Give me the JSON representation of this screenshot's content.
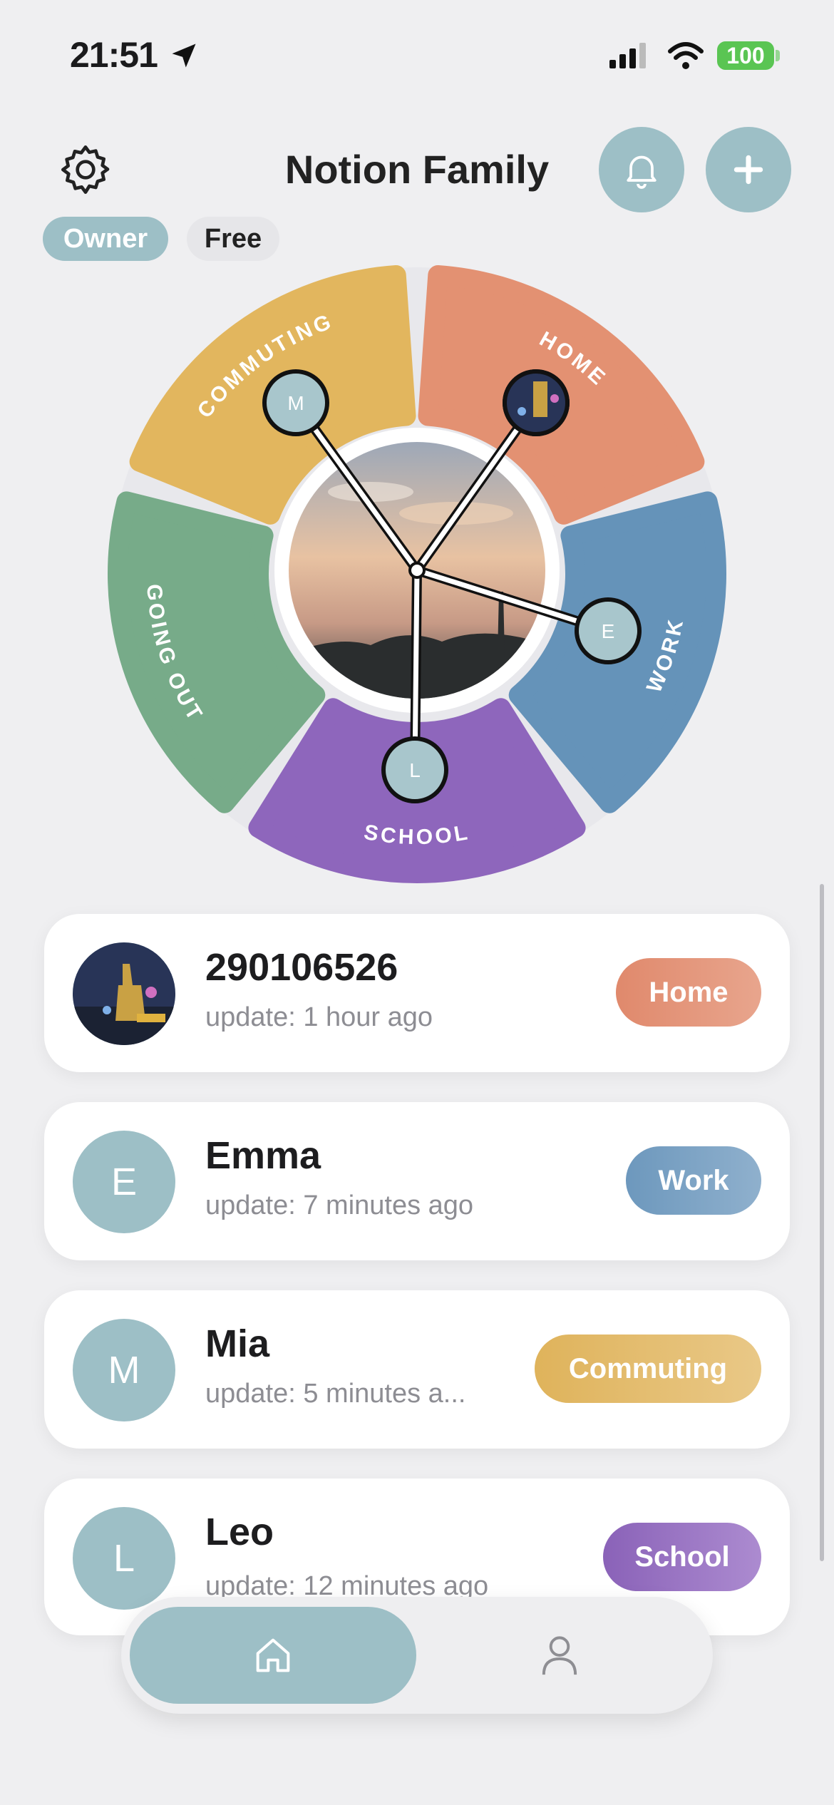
{
  "status_bar": {
    "time": "21:51",
    "battery": "100"
  },
  "header": {
    "title": "Notion Family",
    "role_badge": "Owner",
    "plan_badge": "Free"
  },
  "wheel": {
    "segments": [
      {
        "label": "COMMUTING",
        "color": "#e2b65e"
      },
      {
        "label": "HOME",
        "color": "#e39172"
      },
      {
        "label": "WORK",
        "color": "#6593b9"
      },
      {
        "label": "SCHOOL",
        "color": "#8e66bc"
      },
      {
        "label": "GOING OUT",
        "color": "#77ab89"
      }
    ],
    "markers": [
      {
        "initial": "M",
        "segment": "COMMUTING"
      },
      {
        "initial": "",
        "segment": "HOME"
      },
      {
        "initial": "E",
        "segment": "WORK"
      },
      {
        "initial": "L",
        "segment": "SCHOOL"
      }
    ]
  },
  "members": [
    {
      "name": "290106526",
      "update": "update: 1 hour ago",
      "initial": "",
      "status": "Home",
      "status_color": "#e3957b"
    },
    {
      "name": "Emma",
      "update": "update: 7 minutes ago",
      "initial": "E",
      "status": "Work",
      "status_color": "#7da3c3"
    },
    {
      "name": "Mia",
      "update": "update: 5 minutes a...",
      "initial": "M",
      "status": "Commuting",
      "status_color": "#e3bb6a"
    },
    {
      "name": "Leo",
      "update": "update: 12 minutes ago",
      "initial": "L",
      "status": "School",
      "status_color": "#9a77c4"
    }
  ],
  "tab_bar": {
    "tabs": [
      {
        "icon": "home-icon",
        "selected": true
      },
      {
        "icon": "profile-icon",
        "selected": false
      }
    ]
  },
  "colors": {
    "accent": "#9dbfc6",
    "background": "#efeff1"
  }
}
